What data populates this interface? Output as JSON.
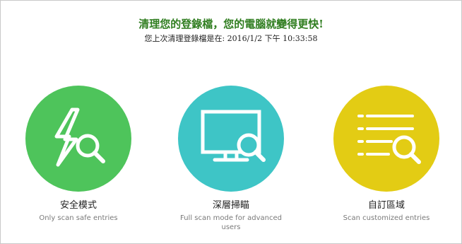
{
  "header": {
    "title": "清理您的登錄檔，您的電腦就變得更快!",
    "last_cleaned": "您上次清理登錄檔是在: 2016/1/2 下午 10:33:58"
  },
  "modes": [
    {
      "title": "安全模式",
      "description": "Only scan safe entries",
      "color": "#4ec45b",
      "icon": "lightning-magnifier-icon"
    },
    {
      "title": "深層掃瞄",
      "description": "Full scan mode for advanced users",
      "color": "#3ec5c6",
      "icon": "monitor-magnifier-icon"
    },
    {
      "title": "自訂區域",
      "description": "Scan customized entries",
      "color": "#e3cc14",
      "icon": "list-magnifier-icon"
    }
  ]
}
